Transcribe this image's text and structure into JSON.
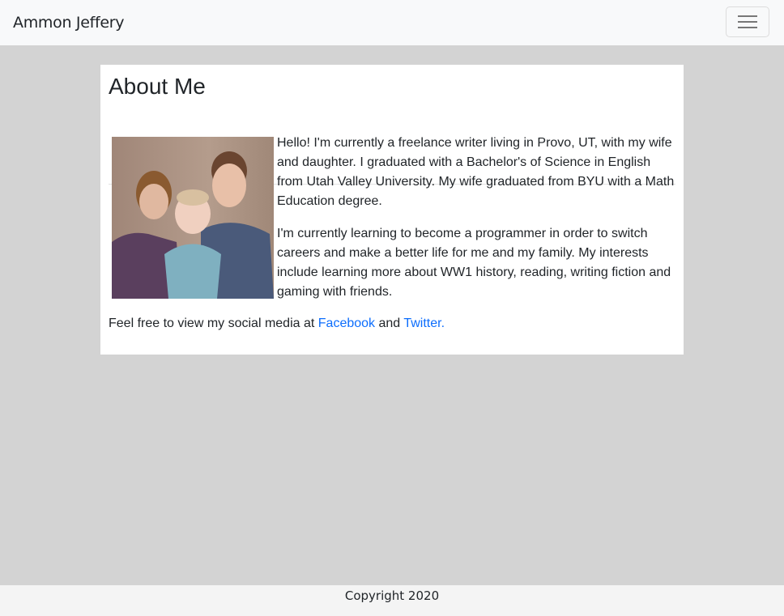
{
  "navbar": {
    "brand": "Ammon Jeffery",
    "toggler_icon": "hamburger-icon"
  },
  "card": {
    "title": "About Me",
    "paragraphs": [
      "Hello! I'm currently a freelance writer living in Provo, UT, with my wife and daughter. I graduated with a Bachelor's of Science in English from Utah Valley University. My wife graduated from BYU with a Math Education degree.",
      "I'm currently learning to become a programmer in order to switch careers and make a better life for me and my family. My interests include learning more about WW1 history, reading, writing fiction and gaming with friends."
    ],
    "social": {
      "prefix": "Feel free to view my social media at ",
      "facebook": "Facebook",
      "and": " and ",
      "twitter": "Twitter."
    }
  },
  "footer": {
    "copyright": "Copyright 2020"
  },
  "colors": {
    "link": "#0d6efd",
    "background": "#d3d3d3"
  }
}
